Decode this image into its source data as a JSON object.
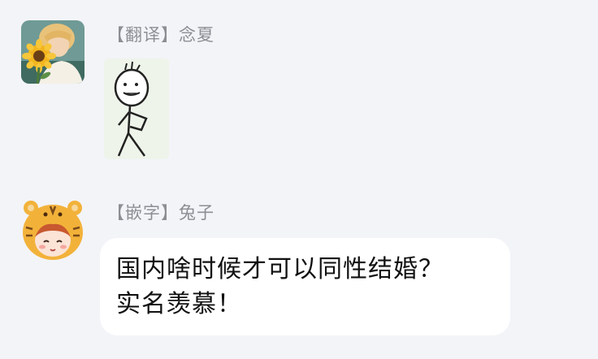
{
  "messages": [
    {
      "sender_tag": "翻译",
      "sender_name": "念夏",
      "avatar": "sunflower-boy-avatar",
      "content_type": "sticker",
      "sticker": "stick-figure-sticker"
    },
    {
      "sender_tag": "嵌字",
      "sender_name": "兔子",
      "avatar": "tiger-hood-girl-avatar",
      "content_type": "text",
      "text": "国内啥时候才可以同性结婚？\n实名羡慕！"
    }
  ]
}
